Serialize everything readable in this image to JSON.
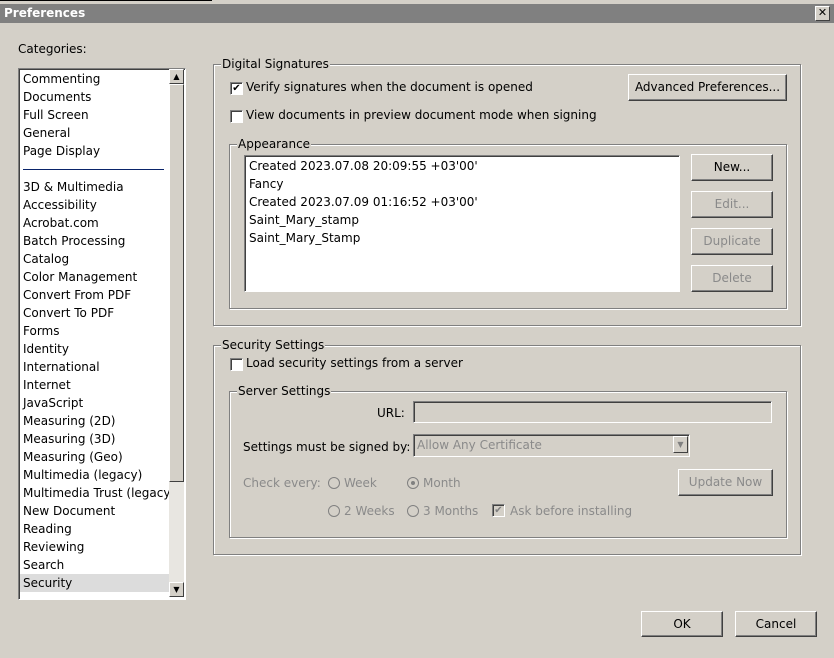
{
  "window": {
    "title": "Preferences",
    "close_glyph": "✕"
  },
  "categories": {
    "label": "Categories:",
    "top_items": [
      "Commenting",
      "Documents",
      "Full Screen",
      "General",
      "Page Display"
    ],
    "items": [
      "3D & Multimedia",
      "Accessibility",
      "Acrobat.com",
      "Batch Processing",
      "Catalog",
      "Color Management",
      "Convert From PDF",
      "Convert To PDF",
      "Forms",
      "Identity",
      "International",
      "Internet",
      "JavaScript",
      "Measuring (2D)",
      "Measuring (3D)",
      "Measuring (Geo)",
      "Multimedia (legacy)",
      "Multimedia Trust (legacy)",
      "New Document",
      "Reading",
      "Reviewing",
      "Search",
      "Security"
    ],
    "selected": "Security"
  },
  "digital_signatures": {
    "legend": "Digital Signatures",
    "verify_label": "Verify signatures when the document is opened",
    "verify_checked": true,
    "preview_label": "View documents in preview document mode when signing",
    "preview_checked": false,
    "advanced_button": "Advanced Preferences...",
    "appearance": {
      "legend": "Appearance",
      "items": [
        "Created 2023.07.08 20:09:55 +03'00'",
        "Fancy",
        "Created 2023.07.09 01:16:52 +03'00'",
        "Saint_Mary_stamp",
        "Saint_Mary_Stamp"
      ],
      "new_button": "New...",
      "edit_button": "Edit...",
      "duplicate_button": "Duplicate",
      "delete_button": "Delete"
    }
  },
  "security_settings": {
    "legend": "Security Settings",
    "load_label": "Load security settings from a server",
    "load_checked": false,
    "server": {
      "legend": "Server Settings",
      "url_label": "URL:",
      "url_value": "",
      "signed_by_label": "Settings must be signed by:",
      "signed_by_value": "Allow Any Certificate",
      "check_every_label": "Check every:",
      "week": "Week",
      "month": "Month",
      "two_weeks": "2 Weeks",
      "three_months": "3 Months",
      "ask_label": "Ask before installing",
      "ask_checked": true,
      "update_button": "Update Now"
    }
  },
  "footer": {
    "ok": "OK",
    "cancel": "Cancel"
  }
}
